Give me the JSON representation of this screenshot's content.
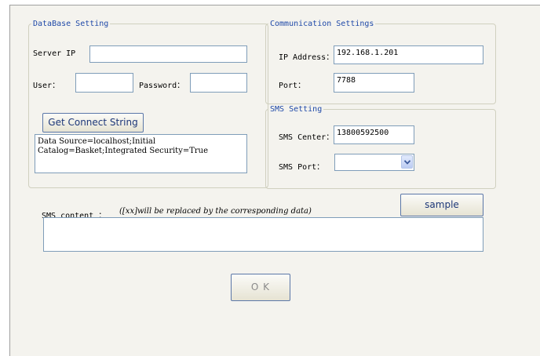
{
  "database": {
    "legend": "DataBase Setting",
    "server_ip_label": "Server IP",
    "server_ip_value": "",
    "user_label": "User：",
    "user_value": "",
    "password_label": "Password：",
    "password_value": "",
    "get_connect_button": "Get Connect String",
    "connect_string": "Data Source=localhost;Initial\nCatalog=Basket;Integrated Security=True"
  },
  "communication": {
    "legend": "Communication Settings",
    "ip_label": "IP Address：",
    "ip_value": "192.168.1.201",
    "port_label": "Port：",
    "port_value": "7788"
  },
  "sms": {
    "legend": "SMS Setting",
    "center_label": "SMS Center：",
    "center_value": "13800592500",
    "port_label": "SMS Port：",
    "port_value": ""
  },
  "content": {
    "label": "SMS content ：",
    "hint": "([xx]will be replaced by the corresponding data)",
    "sample_button": "sample",
    "value": ""
  },
  "ok_button": "O K"
}
